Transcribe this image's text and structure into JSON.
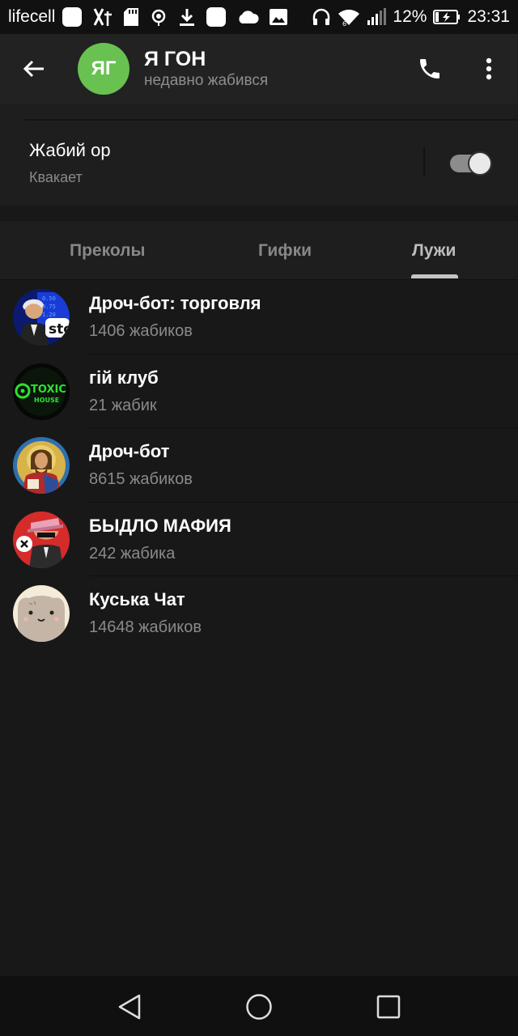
{
  "status_bar": {
    "carrier": "lifecell",
    "battery": "12%",
    "time": "23:31",
    "icons_left": [
      "app-square-icon",
      "translate-icon",
      "sd-card-icon",
      "hotspot-icon",
      "download-icon",
      "app-square-icon",
      "cloud-icon",
      "image-icon"
    ],
    "icons_right": [
      "headphones-icon",
      "wifi-icon",
      "signal-icon",
      "battery-icon"
    ]
  },
  "header": {
    "avatar_initials": "ЯГ",
    "avatar_color": "#68c150",
    "title": "Я ГОН",
    "subtitle": "недавно жабився"
  },
  "setting": {
    "title": "Жабий ор",
    "subtitle": "Квакает",
    "toggle_on": true
  },
  "tabs": [
    {
      "label": "Преколы",
      "active": false
    },
    {
      "label": "Гифки",
      "active": false
    },
    {
      "label": "Лужи",
      "active": true
    }
  ],
  "chats": [
    {
      "title": "Дроч-бот: торговля",
      "subtitle": "1406 жабиков",
      "avatar": "stocks-avatar"
    },
    {
      "title": "гій клуб",
      "subtitle": "21 жабик",
      "avatar": "toxic-house-avatar",
      "avatar_text": [
        "TOXIC",
        "HOUSE"
      ]
    },
    {
      "title": "Дроч-бот",
      "subtitle": "8615 жабиков",
      "avatar": "icon-avatar"
    },
    {
      "title": "БЫДЛО МАФИЯ",
      "subtitle": "242 жабика",
      "avatar": "mafia-avatar"
    },
    {
      "title": "Куська Чат",
      "subtitle": "14648 жабиков",
      "avatar": "cat-avatar"
    }
  ],
  "nav": [
    "back-nav-icon",
    "home-nav-icon",
    "recents-nav-icon"
  ]
}
